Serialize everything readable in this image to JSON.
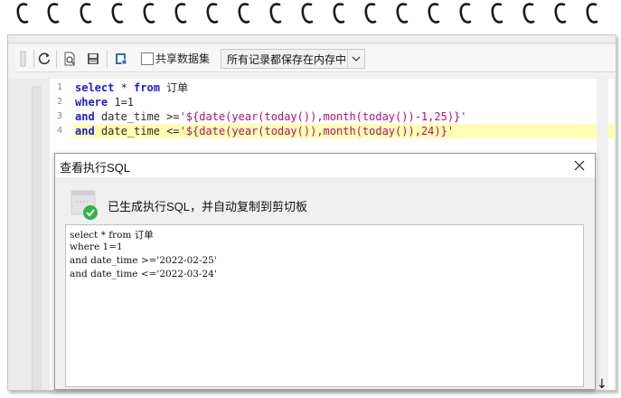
{
  "toolbar": {
    "share_dataset_label": "共享数据集",
    "share_dataset_checked": false,
    "storage_mode_value": "所有记录都保存在内存中"
  },
  "editor": {
    "lines": [
      {
        "number": "1",
        "tokens": [
          {
            "t": "select",
            "c": "kw"
          },
          {
            "t": " * ",
            "c": ""
          },
          {
            "t": "from",
            "c": "kw"
          },
          {
            "t": " 订单",
            "c": ""
          }
        ]
      },
      {
        "number": "2",
        "tokens": [
          {
            "t": "where",
            "c": "kw"
          },
          {
            "t": " 1=1",
            "c": ""
          }
        ]
      },
      {
        "number": "3",
        "tokens": [
          {
            "t": "and",
            "c": "kw"
          },
          {
            "t": " date_time >=",
            "c": ""
          },
          {
            "t": "'${date(year(today()),month(today())-1,25)}'",
            "c": "str"
          }
        ]
      },
      {
        "number": "4",
        "tokens": [
          {
            "t": "and",
            "c": "kw"
          },
          {
            "t": " date_time <=",
            "c": ""
          },
          {
            "t": "'${date(year(today()),month(today()),24)}'",
            "c": "str"
          }
        ]
      }
    ],
    "highlighted_line": 4
  },
  "dialog": {
    "title": "查看执行SQL",
    "message": "已生成执行SQL，并自动复制到剪切板",
    "output": [
      "select * from 订单",
      "where 1=1",
      "and date_time >='2022-02-25'",
      "and date_time <='2022-03-24'"
    ]
  },
  "colors": {
    "keyword": "#1b1bd6",
    "string": "#b01077",
    "highlight": "#ffffb4",
    "success": "#2fb34a"
  }
}
